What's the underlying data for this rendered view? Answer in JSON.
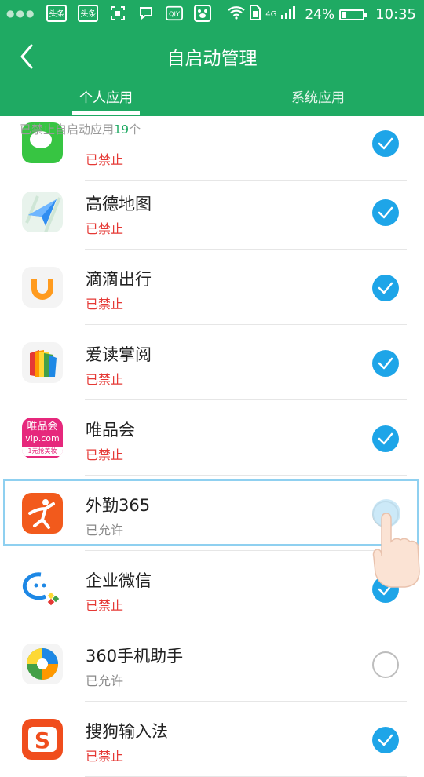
{
  "status_bar": {
    "notif_icons": [
      "头条",
      "头条"
    ],
    "network": "4G",
    "battery": "24%",
    "battery_level": 0.24,
    "time": "10:35"
  },
  "header": {
    "title": "自启动管理",
    "tabs": [
      {
        "label": "个人应用",
        "active": true
      },
      {
        "label": "系统应用",
        "active": false
      }
    ]
  },
  "summary": {
    "prefix": "已禁止自启动应用",
    "count": "19",
    "suffix": "个"
  },
  "apps": [
    {
      "name": "",
      "status": "已禁止",
      "allowed": false,
      "checked": true,
      "icon": "wechat-icon"
    },
    {
      "name": "高德地图",
      "status": "已禁止",
      "allowed": false,
      "checked": true,
      "icon": "amap-icon"
    },
    {
      "name": "滴滴出行",
      "status": "已禁止",
      "allowed": false,
      "checked": true,
      "icon": "didi-icon"
    },
    {
      "name": "爱读掌阅",
      "status": "已禁止",
      "allowed": false,
      "checked": true,
      "icon": "ireader-icon"
    },
    {
      "name": "唯品会",
      "status": "已禁止",
      "allowed": false,
      "checked": true,
      "icon": "vip-icon"
    },
    {
      "name": "外勤365",
      "status": "已允许",
      "allowed": true,
      "checked": false,
      "icon": "waiqin365-icon"
    },
    {
      "name": "企业微信",
      "status": "已禁止",
      "allowed": false,
      "checked": true,
      "icon": "wework-icon"
    },
    {
      "name": "360手机助手",
      "status": "已允许",
      "allowed": true,
      "checked": false,
      "icon": "360-assistant-icon"
    },
    {
      "name": "搜狗输入法",
      "status": "已禁止",
      "allowed": false,
      "checked": true,
      "icon": "sogou-icon"
    }
  ],
  "vip_icon_text": {
    "line1": "唯品会",
    "line2": "vip.com",
    "line3": "1元抢美妆"
  },
  "sogou_icon_text": "S",
  "colors": {
    "primary": "#1faa63",
    "check": "#1ea5e8",
    "denied": "#e53935"
  }
}
